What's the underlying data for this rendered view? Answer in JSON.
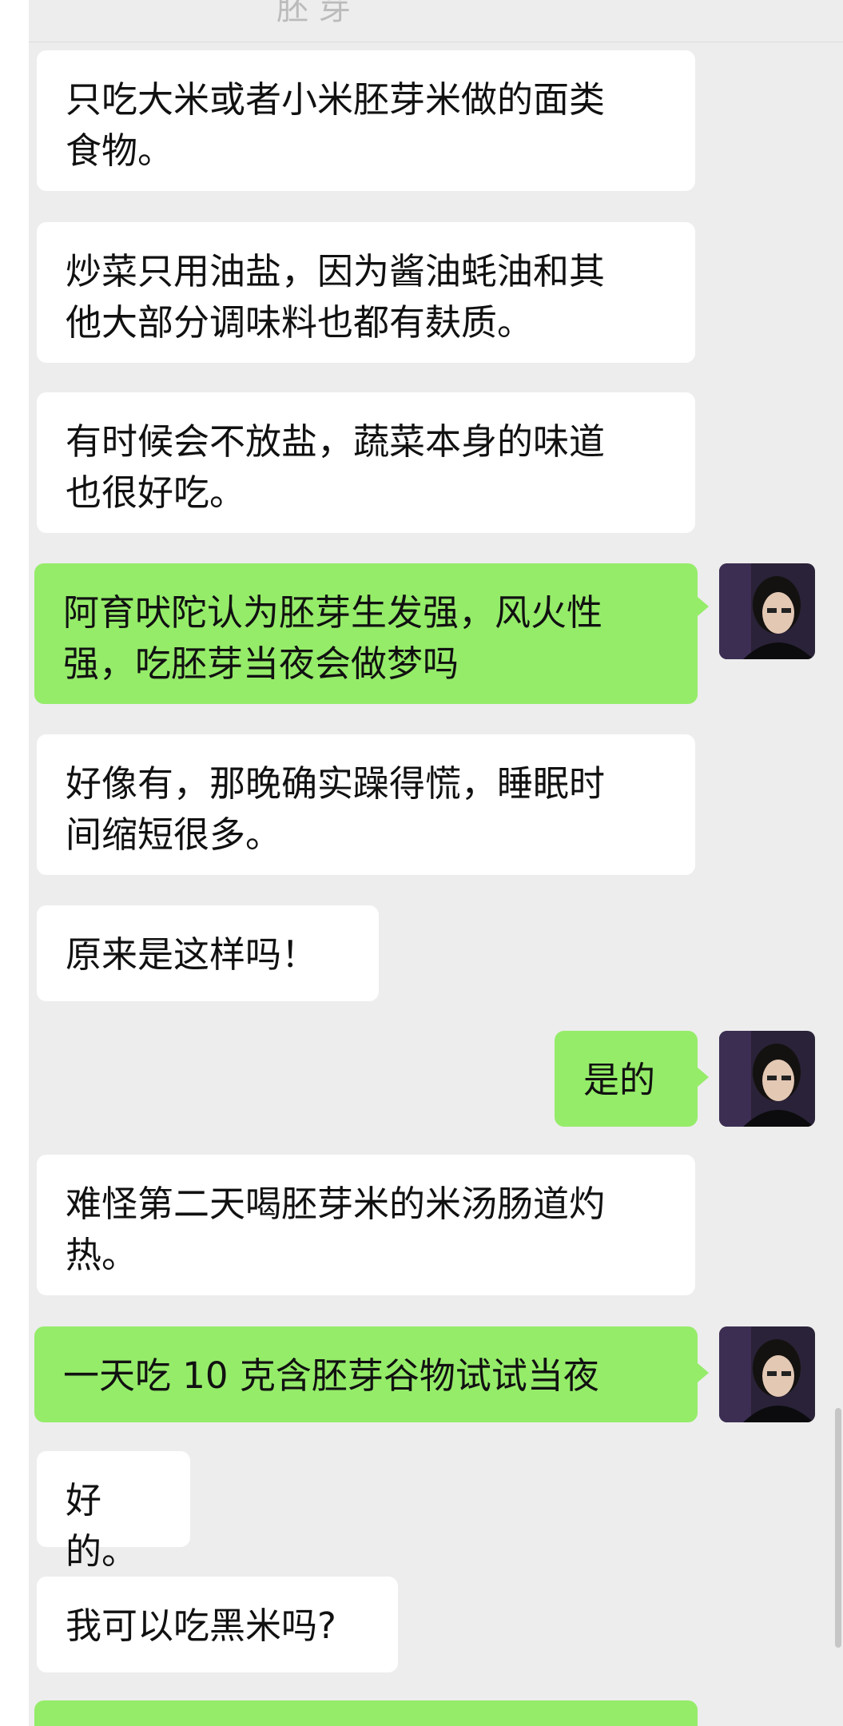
{
  "header": {
    "clipped_title": "胚 芽"
  },
  "messages": [
    {
      "side": "received",
      "text": "只吃大米或者小米胚芽米做的面类\n食物。"
    },
    {
      "side": "received",
      "text": "炒菜只用油盐，因为酱油蚝油和其\n他大部分调味料也都有麸质。"
    },
    {
      "side": "received",
      "text": "有时候会不放盐，蔬菜本身的味道\n也很好吃。"
    },
    {
      "side": "sent",
      "text": "阿育吠陀认为胚芽生发强，风火性\n强，吃胚芽当夜会做梦吗"
    },
    {
      "side": "received",
      "text": "好像有，那晚确实躁得慌，睡眠时\n间缩短很多。"
    },
    {
      "side": "received",
      "text": "原来是这样吗！"
    },
    {
      "side": "sent",
      "text": "是的"
    },
    {
      "side": "received",
      "text": "难怪第二天喝胚芽米的米汤肠道灼\n热。"
    },
    {
      "side": "sent",
      "text": "一天吃 10 克含胚芽谷物试试当夜"
    },
    {
      "side": "received",
      "text": "好的。"
    },
    {
      "side": "received",
      "text": "我可以吃黑米吗?"
    },
    {
      "side": "sent",
      "text": ""
    }
  ],
  "colors": {
    "background": "#ededed",
    "received_bubble": "#ffffff",
    "sent_bubble": "#95ec69"
  },
  "icons": {
    "sender_avatar": "user-avatar-photo"
  }
}
